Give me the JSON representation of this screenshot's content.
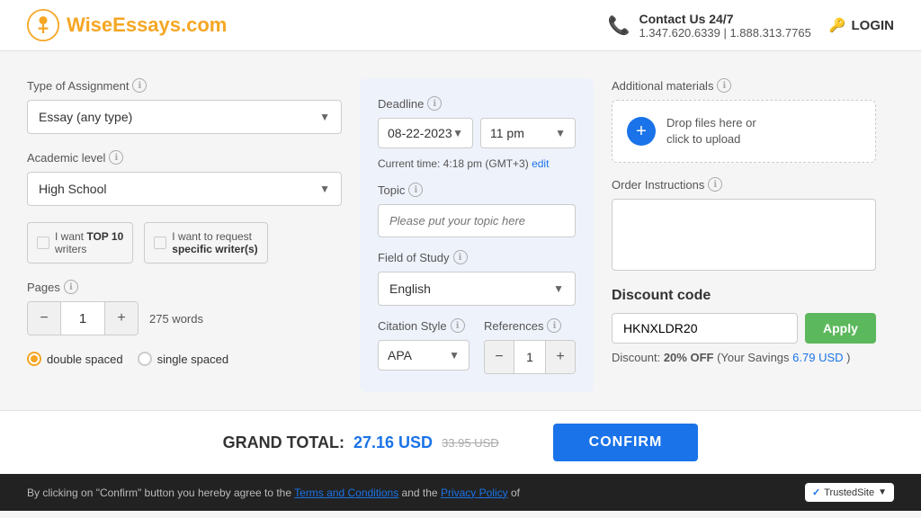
{
  "header": {
    "logo_text_main": "WiseEssays",
    "logo_text_ext": ".com",
    "contact_label": "Contact Us 24/7",
    "phone1": "1.347.620.6339",
    "phone2": "1.888.313.7765",
    "login_label": "LOGIN"
  },
  "left": {
    "assignment_label": "Type of Assignment",
    "assignment_value": "Essay (any type)",
    "academic_label": "Academic level",
    "academic_value": "High School",
    "writer1_label": "I want",
    "writer1_bold": "TOP 10",
    "writer1_sub": "writers",
    "writer2_label": "I want to request",
    "writer2_bold": "specific writer(s)",
    "pages_label": "Pages",
    "pages_value": "1",
    "words_label": "275 words",
    "spacing1": "double spaced",
    "spacing2": "single spaced"
  },
  "middle": {
    "deadline_label": "Deadline",
    "deadline_date": "08-22-2023",
    "deadline_time": "11 pm",
    "current_time": "Current time: 4:18 pm (GMT+3)",
    "edit_link": "edit",
    "topic_label": "Topic",
    "topic_placeholder": "Please put your topic here",
    "field_of_study_label": "Field of Study",
    "field_of_study_value": "English",
    "citation_label": "Citation Style",
    "citation_value": "APA",
    "references_label": "References",
    "references_value": "1"
  },
  "right": {
    "additional_materials_label": "Additional materials",
    "upload_text1": "Drop files here or",
    "upload_text2": "click to upload",
    "order_instructions_label": "Order Instructions",
    "discount_title": "Discount code",
    "discount_code": "HKNXLDR20",
    "apply_label": "Apply",
    "discount_info_prefix": "Discount:",
    "discount_pct": "20% OFF",
    "discount_savings_prefix": "(Your Savings",
    "discount_savings": "6.79 USD",
    "discount_savings_suffix": ")"
  },
  "footer": {
    "grand_total_label": "GRAND TOTAL:",
    "grand_total_amount": "27.16 USD",
    "grand_total_original": "33.95 USD",
    "confirm_label": "CONFIRM"
  },
  "bottom_notice": {
    "text1": "By clicking on \"Confirm\" button you hereby agree to the",
    "terms_link": "Terms and Conditions",
    "text2": "and the",
    "privacy_link": "Privacy Policy",
    "text3": "of",
    "trusted_label": "TrustedSite"
  },
  "icons": {
    "info": "ℹ",
    "phone": "📞",
    "key": "🔑",
    "chevron_down": "▼",
    "plus": "+",
    "minus": "−",
    "checkmark": "✓"
  }
}
